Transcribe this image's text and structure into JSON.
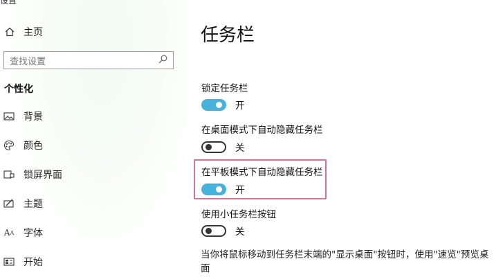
{
  "window": {
    "title": "设置"
  },
  "sidebar": {
    "home_label": "主页",
    "search_placeholder": "查找设置",
    "section_title": "个性化",
    "items": [
      {
        "label": "背景",
        "icon": "picture-icon"
      },
      {
        "label": "颜色",
        "icon": "palette-icon"
      },
      {
        "label": "锁屏界面",
        "icon": "lock-screen-icon"
      },
      {
        "label": "主题",
        "icon": "theme-brush-icon"
      },
      {
        "label": "字体",
        "icon": "font-icon"
      },
      {
        "label": "开始",
        "icon": "start-icon"
      }
    ]
  },
  "main": {
    "page_title": "任务栏",
    "settings": [
      {
        "label": "锁定任务栏",
        "state": "开",
        "on": true
      },
      {
        "label": "在桌面模式下自动隐藏任务栏",
        "state": "关",
        "on": false
      },
      {
        "label": "在平板模式下自动隐藏任务栏",
        "state": "开",
        "on": true
      },
      {
        "label": "使用小任务栏按钮",
        "state": "关",
        "on": false
      }
    ],
    "description": "当你将鼠标移动到任务栏末端的\"显示桌面\"按钮时，使用\"速览\"预览桌面"
  },
  "colors": {
    "accent": "#46b1da",
    "highlight": "#d9709a"
  }
}
